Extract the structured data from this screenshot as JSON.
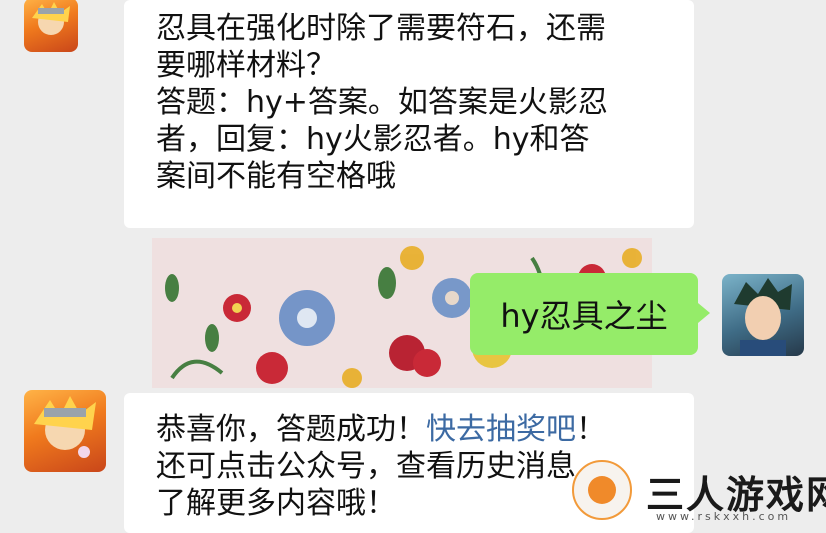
{
  "chat": {
    "msg1_line1": "忍具在强化时除了需要符石，还需",
    "msg1_line2": "要哪样材料？",
    "msg1_line3": "答题：hy+答案。如答案是火影忍",
    "msg1_line4": "者，回复：hy火影忍者。hy和答",
    "msg1_line5": "案间不能有空格哦",
    "reply": "hy忍具之尘",
    "msg2_part1": "恭喜你，答题成功！",
    "msg2_link": "快去抽奖吧",
    "msg2_part2": "！",
    "msg2_line2": "还可点击公众号，查看历史消息",
    "msg2_line3": "了解更多内容哦！"
  },
  "watermark": {
    "title": "三人游戏网",
    "url": "www.rskxxh.com"
  },
  "colors": {
    "background": "#ededed",
    "bubble": "#ffffff",
    "sent_bubble": "#95ec69",
    "link": "#3c6aa3"
  },
  "icons": [
    "bot-avatar-icon",
    "user-avatar-icon",
    "site-logo-icon"
  ]
}
